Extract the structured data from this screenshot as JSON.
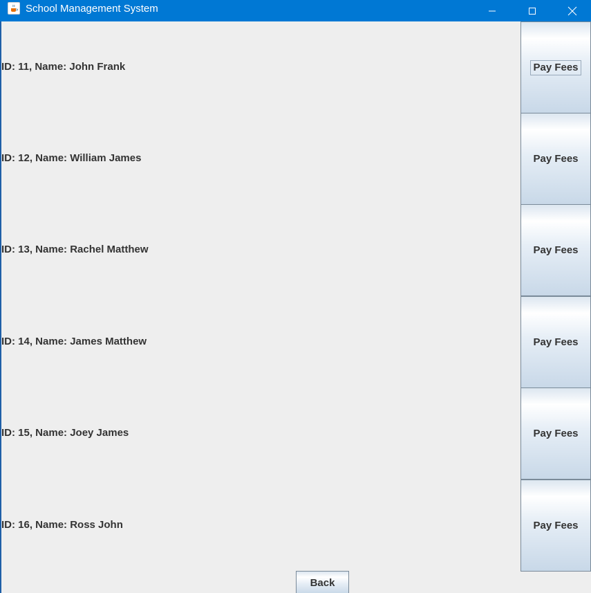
{
  "window": {
    "title": "School Management System",
    "title_bar_color": "#0078d4"
  },
  "students": [
    {
      "label": "ID: 11, Name: John Frank",
      "button_label": "Pay Fees"
    },
    {
      "label": "ID: 12, Name: William James",
      "button_label": "Pay Fees"
    },
    {
      "label": "ID: 13, Name: Rachel Matthew",
      "button_label": "Pay Fees"
    },
    {
      "label": "ID: 14, Name: James Matthew",
      "button_label": "Pay Fees"
    },
    {
      "label": "ID: 15, Name: Joey James",
      "button_label": "Pay Fees"
    },
    {
      "label": "ID: 16, Name: Ross John",
      "button_label": "Pay Fees"
    }
  ],
  "footer": {
    "back_label": "Back"
  },
  "icons": {
    "app": "java-cup-icon",
    "minimize": "minimize-icon",
    "maximize": "maximize-icon",
    "close": "close-icon"
  }
}
